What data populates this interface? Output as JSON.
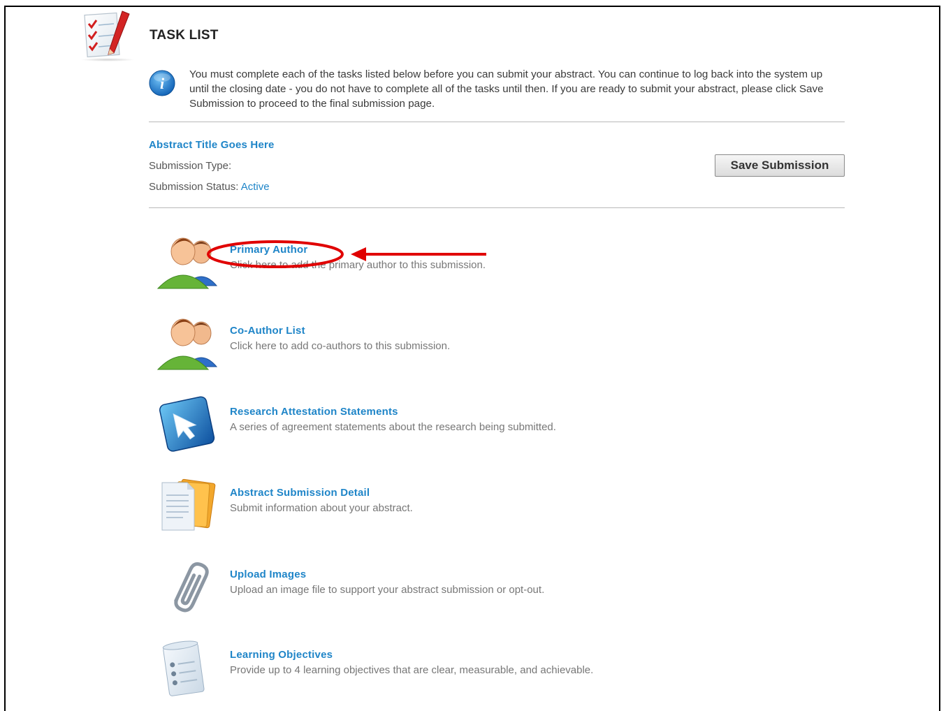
{
  "page": {
    "title": "TASK LIST",
    "info_text": "You must complete each of the tasks listed below before you can submit your abstract. You can continue to log back into the system up until the closing date - you do not have to complete all of the tasks until then. If you are ready to submit your abstract, please click Save Submission to proceed to the final submission page."
  },
  "submission": {
    "title": "Abstract Title Goes Here",
    "type_label": "Submission Type:",
    "type_value": "",
    "status_label": "Submission Status:",
    "status_value": "Active",
    "save_label": "Save Submission"
  },
  "tasks": [
    {
      "label": "Primary Author",
      "description": "Click here to add the primary author to this submission.",
      "icon": "primary-author-icon",
      "highlighted": true
    },
    {
      "label": "Co-Author List",
      "description": "Click here to add co-authors to this submission.",
      "icon": "co-author-icon"
    },
    {
      "label": "Research Attestation Statements",
      "description": "A series of agreement statements about the research being submitted.",
      "icon": "cursor-arrow-icon"
    },
    {
      "label": "Abstract Submission Detail",
      "description": "Submit information about your abstract.",
      "icon": "documents-icon"
    },
    {
      "label": "Upload Images",
      "description": "Upload an image file to support your abstract submission or opt-out.",
      "icon": "paperclip-icon"
    },
    {
      "label": "Learning Objectives",
      "description": "Provide up to 4 learning objectives that are clear, measurable, and achievable.",
      "icon": "scroll-list-icon"
    }
  ],
  "colors": {
    "link": "#1f85c8",
    "annotation": "#e00000"
  }
}
